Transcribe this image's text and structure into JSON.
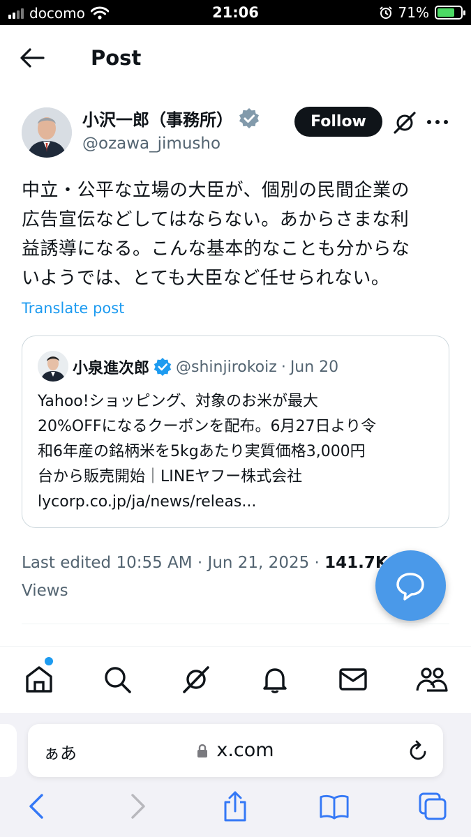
{
  "status_bar": {
    "carrier": "docomo",
    "time": "21:06",
    "battery": "71%"
  },
  "header": {
    "title": "Post"
  },
  "author": {
    "name": "小沢一郎（事務所）",
    "handle": "@ozawa_jimusho",
    "follow_label": "Follow"
  },
  "post": {
    "lines": [
      "中立・公平な立場の大臣が、個別の民間企業の",
      "広告宣伝などしてはならない。あからさまな利",
      "益誘導になる。こんな基本的なことも分からな",
      "いようでは、とても大臣など任せられない。"
    ],
    "translate_label": "Translate post"
  },
  "quote": {
    "name": "小泉進次郎",
    "handle": "@shinjirokoiz",
    "separator": "·",
    "date": "Jun 20",
    "lines": [
      "Yahoo!ショッピング、対象のお米が最大",
      "20%OFFになるクーポンを配布。6月27日より令",
      "和6年産の銘柄米を5kgあたり実質価格3,000円",
      "台から販売開始｜LINEヤフー株式会社",
      "lycorp.co.jp/ja/news/releas..."
    ]
  },
  "meta": {
    "edited": "Last edited 10:55 AM · Jun 21, 2025 ·",
    "views_count": "141.7K",
    "views_label": "Views"
  },
  "bottom_nav": {
    "items": [
      "home-icon",
      "search-icon",
      "grok-icon",
      "notifications-icon",
      "messages-icon",
      "communities-icon"
    ]
  },
  "browser": {
    "aa_label": "ぁあ",
    "url": "x.com"
  },
  "colors": {
    "accent": "#1d9bf0",
    "fab": "#4a99e9",
    "verified": "#1d9bf0",
    "verified_gray": "#829aab"
  }
}
